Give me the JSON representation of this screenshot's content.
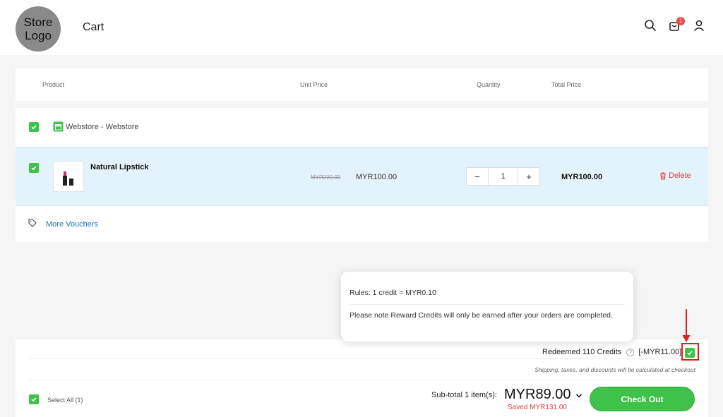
{
  "header": {
    "logo_text": "Store Logo",
    "title": "Cart",
    "cart_count": "1",
    "icons": [
      "search-icon",
      "cart-icon",
      "user-icon"
    ]
  },
  "table": {
    "headers": {
      "product": "Product",
      "unit_price": "Unit Price",
      "quantity": "Quantity",
      "total_price": "Total Price"
    }
  },
  "store": {
    "name": "Webstore - Webstore",
    "checked": true
  },
  "item": {
    "checked": true,
    "name": "Natural Lipstick",
    "original_price": "MYR220.00",
    "unit_price": "MYR100.00",
    "quantity": "1",
    "total_price": "MYR100.00",
    "delete_label": "Delete"
  },
  "voucher": {
    "label": "More Vouchers"
  },
  "popover": {
    "rules": "Rules: 1 credit = MYR0.10",
    "note": "Please note Reward Credits will only be earned after your orders are completed."
  },
  "summary": {
    "redeemed_label": "Redeemed 110 Credits",
    "help_glyph": "?",
    "redeemed_amount": "[-MYR11.00]",
    "redeem_checked": true,
    "shipping_note": "Shipping, taxes, and discounts will be calculated at checkout",
    "select_all_label": "Select All (1)",
    "subtotal_label": "Sub-total 1 item(s):",
    "subtotal_amount": "MYR89.00",
    "saved": "Saved MYR131.00",
    "checkout_label": "Check Out"
  },
  "colors": {
    "accent_green": "#3ec24a",
    "link_blue": "#1e6fc7",
    "danger_red": "#e23b3b",
    "row_highlight": "#e3f3fb"
  }
}
